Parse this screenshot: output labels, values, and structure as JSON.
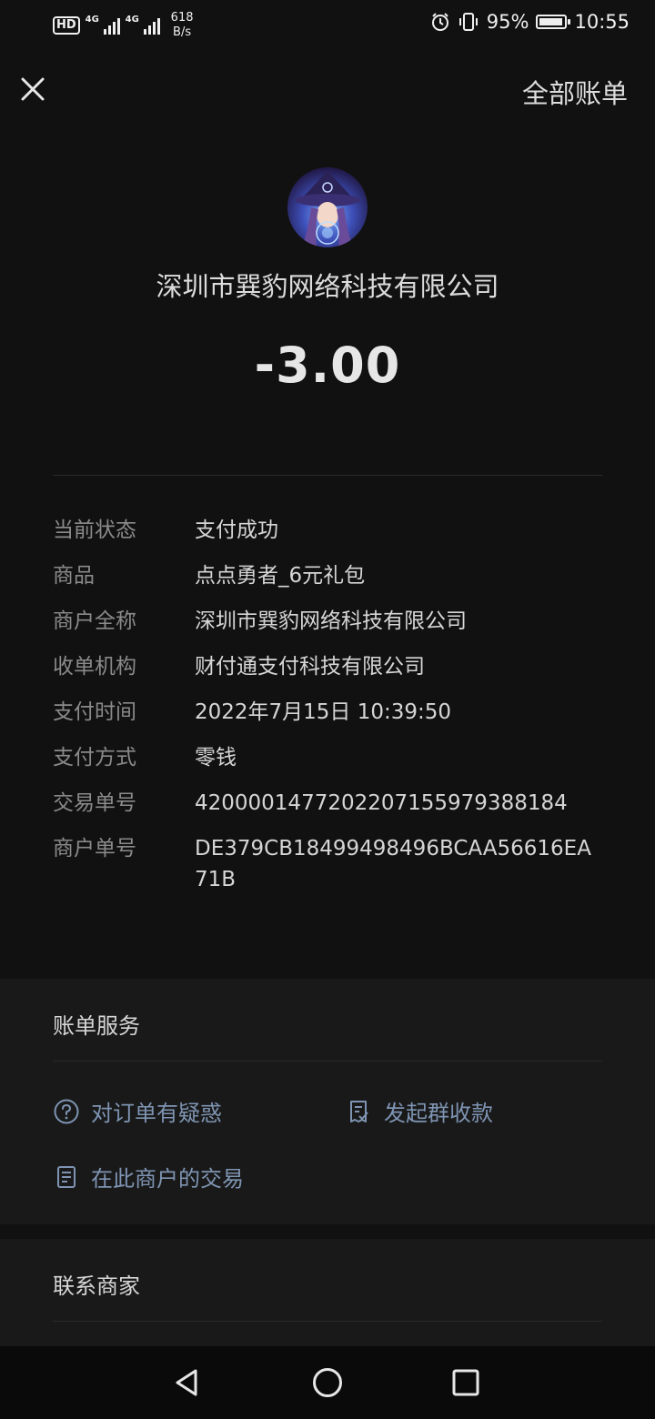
{
  "status_bar": {
    "hd_label": "HD",
    "net1": "4G",
    "net2": "4G",
    "speed_value": "618",
    "speed_unit": "B/s",
    "battery": "95%",
    "battery_level": 0.95,
    "time": "10:55"
  },
  "header": {
    "all_bills": "全部账单"
  },
  "merchant": {
    "name": "深圳市巽豹网络科技有限公司",
    "amount": "-3.00"
  },
  "details": [
    {
      "key": "当前状态",
      "value": "支付成功"
    },
    {
      "key": "商品",
      "value": "点点勇者_6元礼包"
    },
    {
      "key": "商户全称",
      "value": "深圳市巽豹网络科技有限公司"
    },
    {
      "key": "收单机构",
      "value": "财付通支付科技有限公司"
    },
    {
      "key": "支付时间",
      "value": "2022年7月15日 10:39:50"
    },
    {
      "key": "支付方式",
      "value": "零钱"
    },
    {
      "key": "交易单号",
      "value": "4200001477202207155979388184"
    },
    {
      "key": "商户单号",
      "value": "DE379CB18499498496BCAA56616EA71B"
    }
  ],
  "bill_service": {
    "title": "账单服务",
    "question": "对订单有疑惑",
    "group_collect": "发起群收款",
    "merchant_trades": "在此商户的交易"
  },
  "contact": {
    "title": "联系商家"
  },
  "icons": {
    "close": "close-icon",
    "question": "question-circle-icon",
    "group_collect": "receipt-check-icon",
    "merchant_trades": "document-list-icon",
    "nav_back": "triangle-back-icon",
    "nav_home": "circle-home-icon",
    "nav_recent": "square-recent-icon"
  },
  "colors": {
    "background": "#111111",
    "link": "#7e94b2",
    "label": "#8a8a8a"
  }
}
